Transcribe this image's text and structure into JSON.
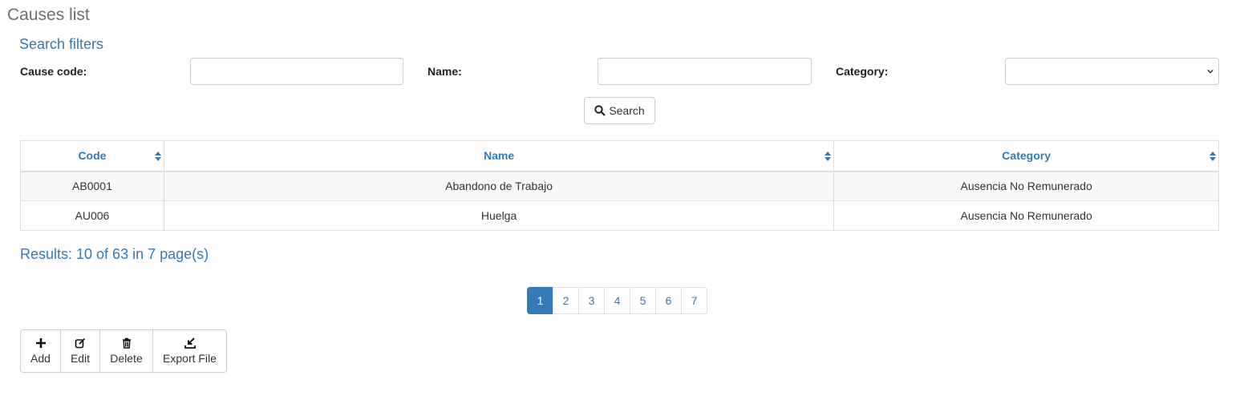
{
  "page": {
    "title": "Causes list"
  },
  "filters": {
    "title": "Search filters",
    "cause_code_label": "Cause code:",
    "cause_code_value": "",
    "name_label": "Name:",
    "name_value": "",
    "category_label": "Category:",
    "category_value": "",
    "search_label": "Search",
    "search_icon": "search-icon"
  },
  "table": {
    "headers": [
      "Code",
      "Name",
      "Category"
    ],
    "rows": [
      [
        "AB0001",
        "Abandono de Trabajo",
        "Ausencia No Remunerado"
      ],
      [
        "AU006",
        "Huelga",
        "Ausencia No Remunerado"
      ]
    ]
  },
  "results": {
    "text": "Results: 10 of 63 in 7 page(s)"
  },
  "pagination": {
    "pages": [
      "1",
      "2",
      "3",
      "4",
      "5",
      "6",
      "7"
    ],
    "current": "1"
  },
  "toolbar": {
    "add_label": "Add",
    "edit_label": "Edit",
    "delete_label": "Delete",
    "export_label": "Export File"
  },
  "colors": {
    "accent": "#337ab7",
    "border": "#dddddd",
    "title": "#6f6f6f"
  }
}
